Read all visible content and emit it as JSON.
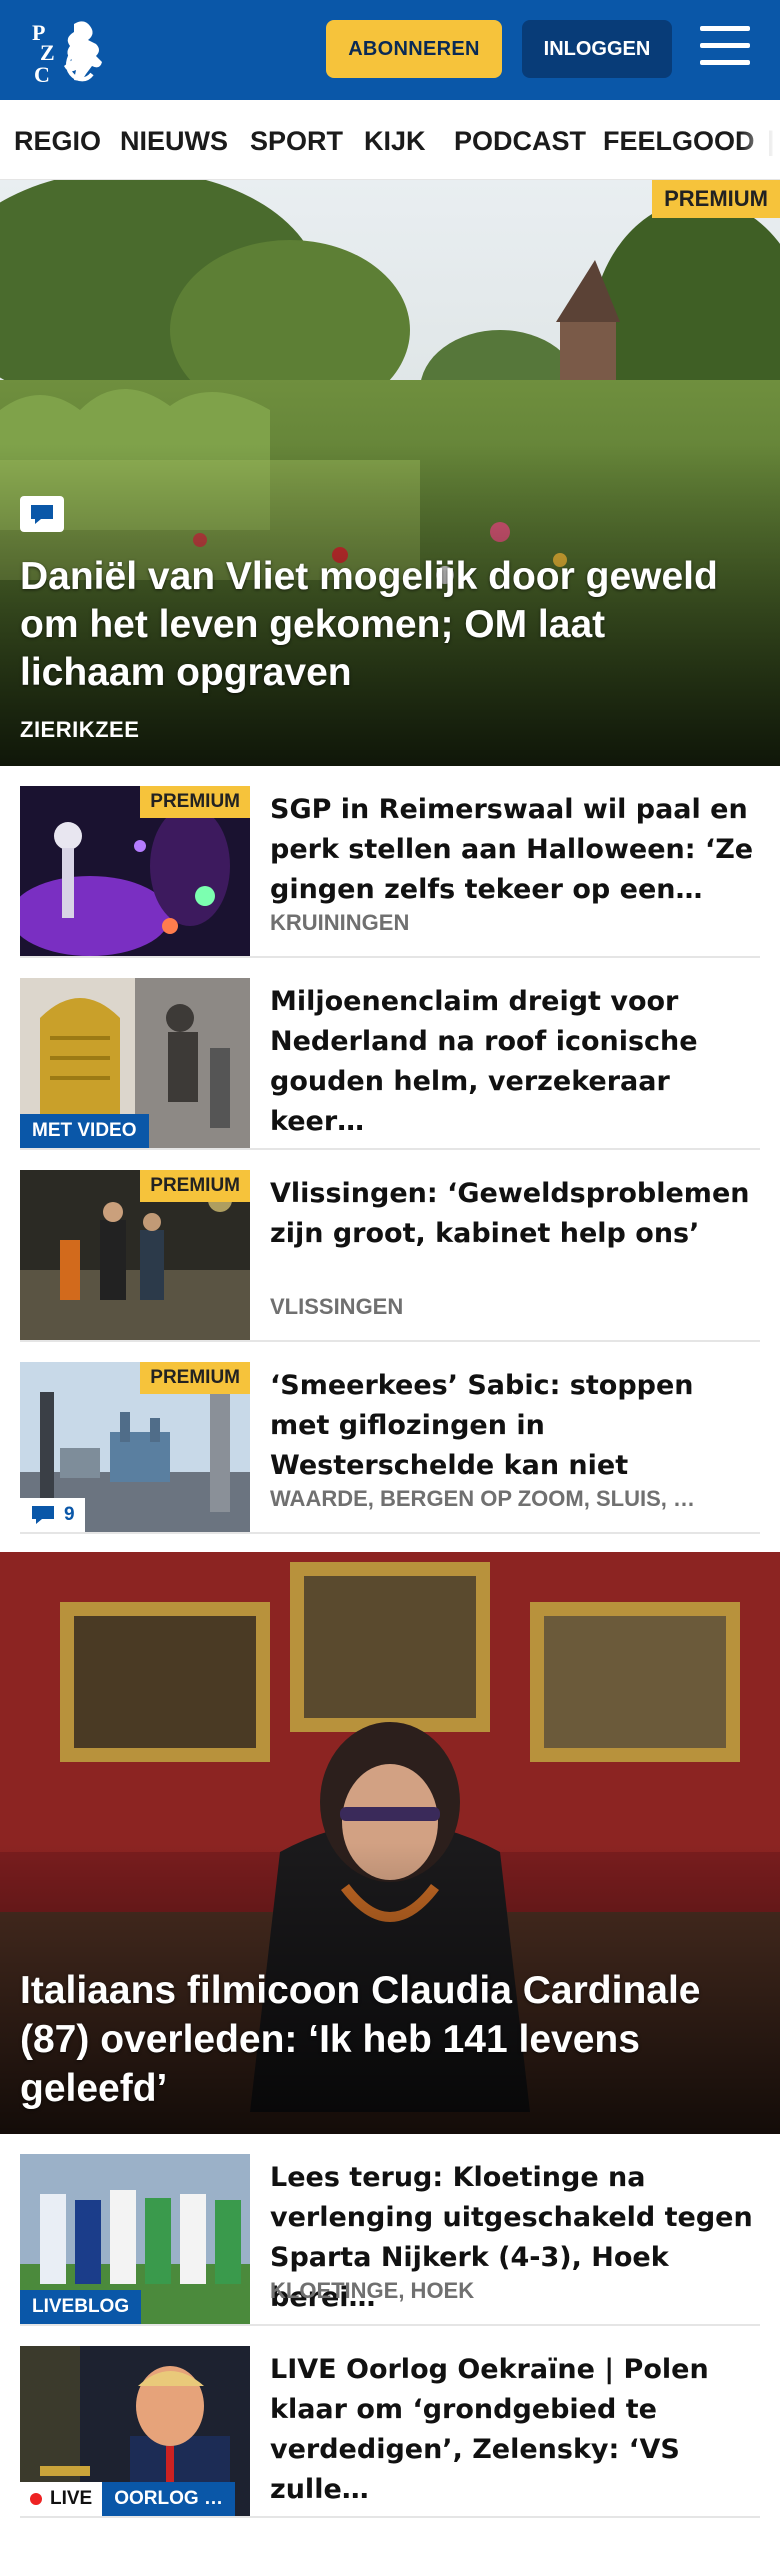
{
  "header": {
    "logo_text": "PZC",
    "subscribe_label": "ABONNEREN",
    "login_label": "INLOGGEN"
  },
  "nav": {
    "items": [
      "REGIO",
      "NIEUWS",
      "SPORT",
      "KIJK",
      "PODCAST",
      "FEELGOOD"
    ]
  },
  "hero": {
    "badge": "PREMIUM",
    "title": "Daniël van Vliet mogelijk door geweld om het leven gekomen; OM laat lichaam opgraven",
    "location": "ZIERIKZEE"
  },
  "articles": [
    {
      "title": "SGP in Reimerswaal wil paal en perk stellen aan Halloween: ‘Ze gingen zelfs tekeer op een…",
      "location": "KRUININGEN",
      "badge": "PREMIUM"
    },
    {
      "title": "Miljoenenclaim dreigt voor Nederland na roof iconische gouden helm, verzekeraar keer…",
      "thumb_label": "MET VIDEO"
    },
    {
      "title": "Vlissingen: ‘Geweldsproblemen zijn groot, kabinet help ons’",
      "location": "VLISSINGEN",
      "badge": "PREMIUM"
    },
    {
      "title": "‘Smeerkees’ Sabic: stoppen met giflozingen in Westerschelde kan niet",
      "location": "WAARDE, BERGEN OP ZOOM, SLUIS, …",
      "badge": "PREMIUM",
      "comment_count": "9"
    }
  ],
  "hero2": {
    "title": "Italiaans filmicoon Claudia Cardinale (87) overleden: ‘Ik heb 141 levens geleefd’"
  },
  "articles2": [
    {
      "title": "Lees terug: Kloetinge na verlenging uitgeschakeld tegen Sparta Nijkerk (4-3), Hoek berei…",
      "location": "KLOETINGE, HOEK",
      "thumb_label": "LIVEBLOG"
    },
    {
      "title": "LIVE Oorlog Oekraïne | Polen klaar om ‘grondgebied te verdedigen’, Zelensky: ‘VS zulle…",
      "live_label": "LIVE",
      "thumb_label": "OORLOG …"
    }
  ],
  "colors": {
    "brand_blue": "#0a57a8",
    "accent_yellow": "#f6c33b"
  }
}
